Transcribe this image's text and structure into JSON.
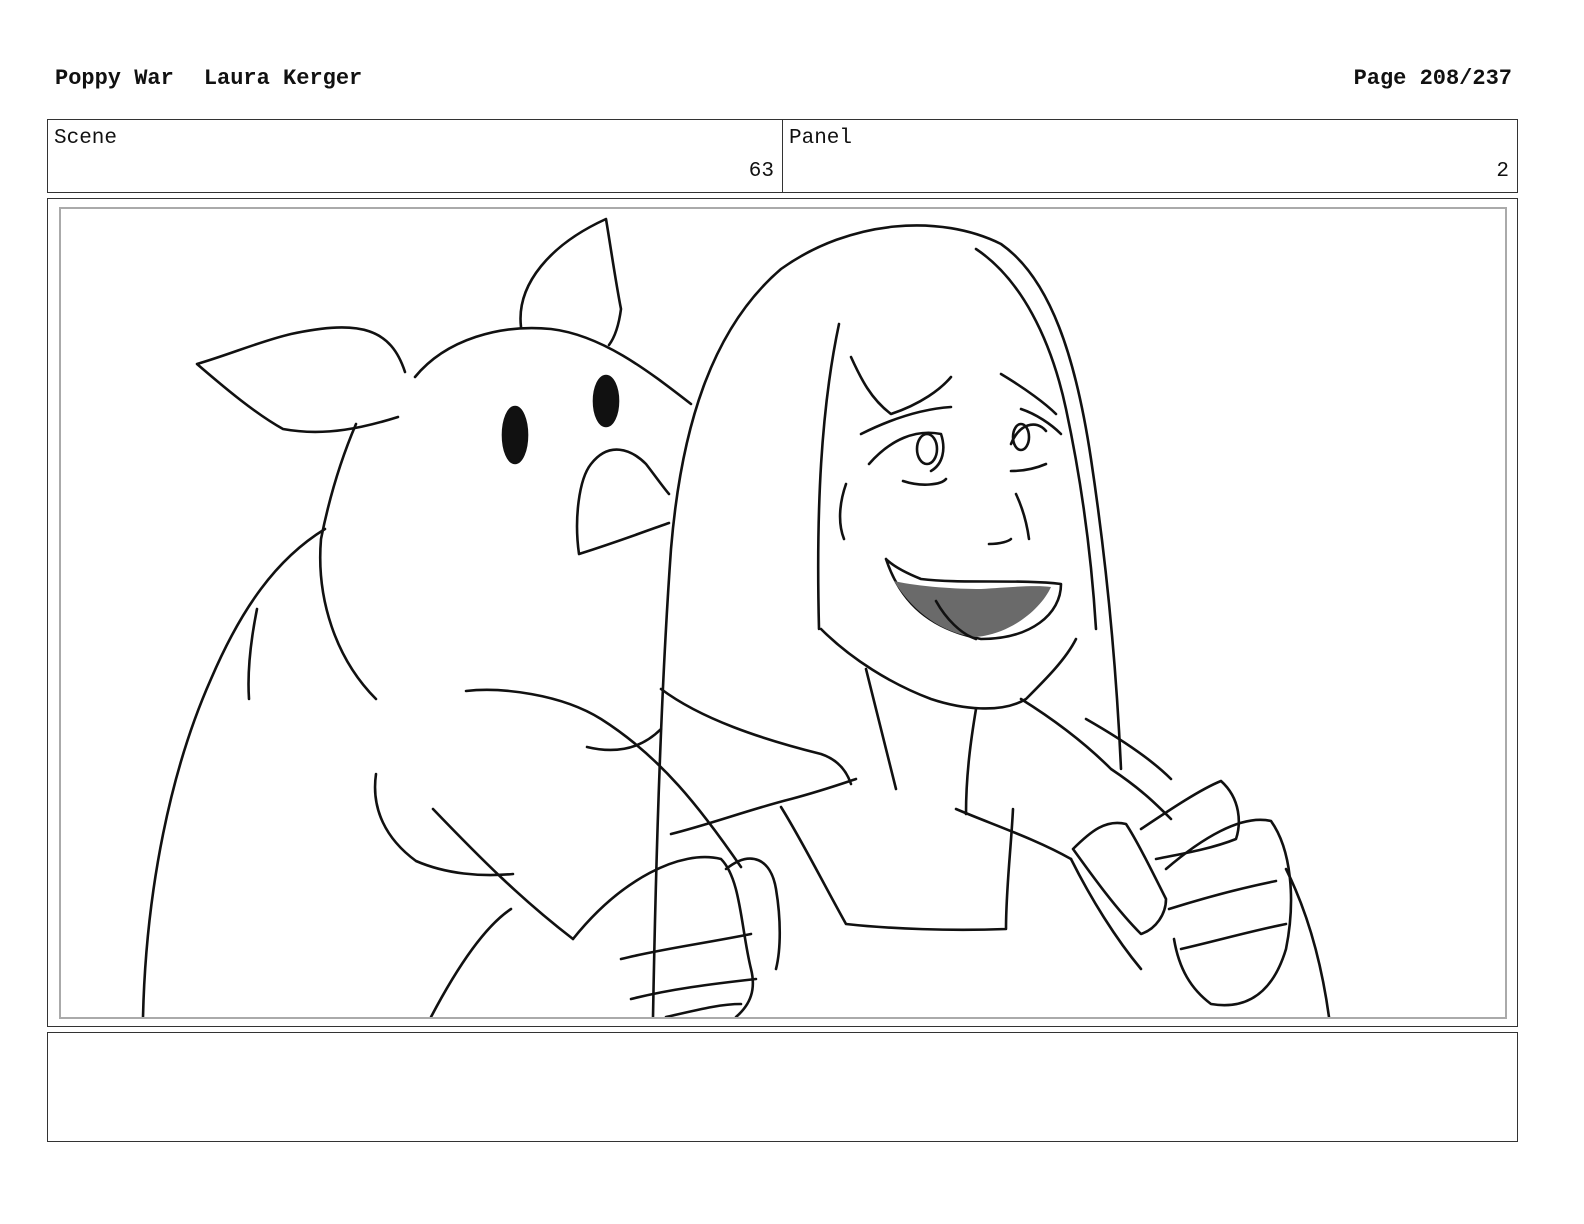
{
  "header": {
    "project": "Poppy War",
    "author": "Laura Kerger",
    "page_label": "Page 208/237"
  },
  "scene": {
    "label": "Scene",
    "value": "63"
  },
  "panel": {
    "label": "Panel",
    "value": "2"
  },
  "notes": {
    "text": ""
  },
  "colors": {
    "ink": "#111111",
    "mouth_fill": "#6a6a6a",
    "inner_frame": "#aaaaaa"
  }
}
